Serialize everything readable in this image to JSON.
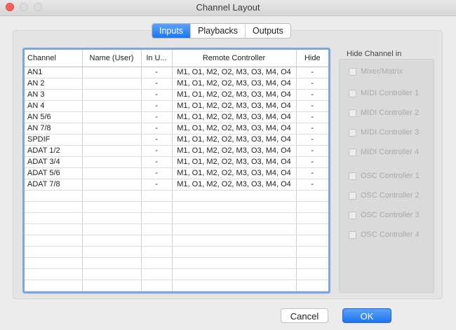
{
  "window": {
    "title": "Channel Layout"
  },
  "tabs": [
    {
      "label": "Inputs",
      "active": true
    },
    {
      "label": "Playbacks",
      "active": false
    },
    {
      "label": "Outputs",
      "active": false
    }
  ],
  "table": {
    "columns": [
      "Channel",
      "Name (User)",
      "In U...",
      "Remote Controller",
      "Hide"
    ],
    "rows": [
      [
        "AN1",
        "",
        "-",
        "M1, O1, M2, O2, M3, O3, M4, O4",
        "-"
      ],
      [
        "AN 2",
        "",
        "-",
        "M1, O1, M2, O2, M3, O3, M4, O4",
        "-"
      ],
      [
        "AN 3",
        "",
        "-",
        "M1, O1, M2, O2, M3, O3, M4, O4",
        "-"
      ],
      [
        "AN 4",
        "",
        "-",
        "M1, O1, M2, O2, M3, O3, M4, O4",
        "-"
      ],
      [
        "AN 5/6",
        "",
        "-",
        "M1, O1, M2, O2, M3, O3, M4, O4",
        "-"
      ],
      [
        "AN 7/8",
        "",
        "-",
        "M1, O1, M2, O2, M3, O3, M4, O4",
        "-"
      ],
      [
        "SPDIF",
        "",
        "-",
        "M1, O1, M2, O2, M3, O3, M4, O4",
        "-"
      ],
      [
        "ADAT 1/2",
        "",
        "-",
        "M1, O1, M2, O2, M3, O3, M4, O4",
        "-"
      ],
      [
        "ADAT 3/4",
        "",
        "-",
        "M1, O1, M2, O2, M3, O3, M4, O4",
        "-"
      ],
      [
        "ADAT 5/6",
        "",
        "-",
        "M1, O1, M2, O2, M3, O3, M4, O4",
        "-"
      ],
      [
        "ADAT 7/8",
        "",
        "-",
        "M1, O1, M2, O2, M3, O3, M4, O4",
        "-"
      ]
    ]
  },
  "hide_panel": {
    "label": "Hide Channel in",
    "options": [
      {
        "label": "Mixer/Matrix",
        "checked": false,
        "enabled": false
      },
      {
        "label": "MIDI Controller 1",
        "checked": false,
        "enabled": false
      },
      {
        "label": "MIDI Controller 2",
        "checked": false,
        "enabled": false
      },
      {
        "label": "MIDI Controller 3",
        "checked": false,
        "enabled": false
      },
      {
        "label": "MIDI Controller 4",
        "checked": false,
        "enabled": false
      },
      {
        "label": "OSC Controller 1",
        "checked": false,
        "enabled": false
      },
      {
        "label": "OSC Controller 2",
        "checked": false,
        "enabled": false
      },
      {
        "label": "OSC Controller 3",
        "checked": false,
        "enabled": false
      },
      {
        "label": "OSC Controller 4",
        "checked": false,
        "enabled": false
      }
    ]
  },
  "buttons": {
    "cancel": "Cancel",
    "ok": "OK"
  }
}
